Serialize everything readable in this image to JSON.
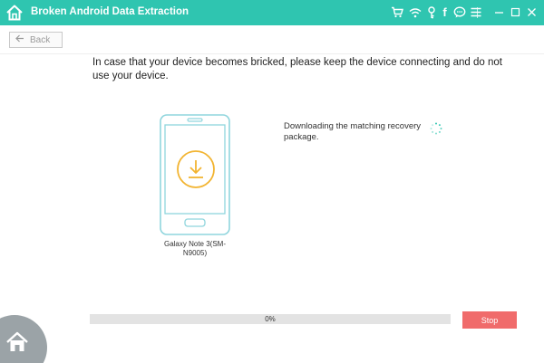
{
  "window": {
    "title": "Broken Android Data Extraction",
    "icons": [
      "cart-icon",
      "wifi-icon",
      "key-icon",
      "facebook-icon",
      "chat-icon",
      "menu-icon"
    ],
    "controls": {
      "minimize": "—",
      "maximize": "☐",
      "close": "✕"
    }
  },
  "nav": {
    "back_label": "Back"
  },
  "message": "In case that your device becomes bricked, please keep the device connecting and do not use your device.",
  "device": {
    "name": "Galaxy Note 3(SM-N9005)"
  },
  "status": {
    "text": "Downloading the matching recovery package."
  },
  "progress": {
    "value": 0,
    "label": "0%"
  },
  "actions": {
    "stop_label": "Stop"
  },
  "colors": {
    "accent": "#2fc5b0",
    "download": "#f2b431",
    "stop": "#f06b6b",
    "fab": "#9ba3a7"
  }
}
